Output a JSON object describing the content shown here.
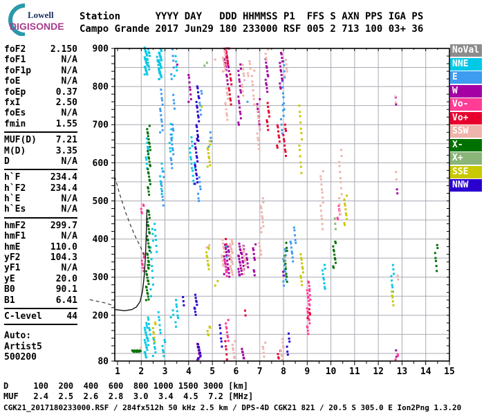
{
  "logo": {
    "line1": "Lowell",
    "line2": "DIGISONDE",
    "arc_color": "#2a99aa"
  },
  "header": {
    "line1": "Station      YYYY DAY   DDD HHMMSS P1  FFS S AXN PPS IGA PS",
    "line2": "Campo Grande 2017 Jun29 180 233000 RSF 005 2 713 100 03+ 36"
  },
  "parameters": {
    "groups": [
      [
        [
          "foF2",
          "2.150"
        ],
        [
          "foF1",
          "N/A"
        ],
        [
          "foF1p",
          "N/A"
        ],
        [
          "foE",
          "N/A"
        ],
        [
          "foEp",
          "0.37"
        ],
        [
          "fxI",
          "2.50"
        ],
        [
          "foEs",
          "N/A"
        ],
        [
          "fmin",
          "1.55"
        ]
      ],
      [
        [
          "MUF(D)",
          "7.21"
        ],
        [
          "M(D)",
          "3.35"
        ],
        [
          "D",
          "N/A"
        ]
      ],
      [
        [
          "h`F",
          "234.4"
        ],
        [
          "h`F2",
          "234.4"
        ],
        [
          "h`E",
          "N/A"
        ],
        [
          "h`Es",
          "N/A"
        ]
      ],
      [
        [
          "hmF2",
          "299.7"
        ],
        [
          "hmF1",
          "N/A"
        ],
        [
          "hmE",
          "110.0"
        ],
        [
          "yF2",
          "104.3"
        ],
        [
          "yF1",
          "N/A"
        ],
        [
          "yE",
          "20.0"
        ],
        [
          "B0",
          "90.1"
        ],
        [
          "B1",
          "6.41"
        ]
      ],
      [
        [
          "C-level",
          "44"
        ]
      ]
    ],
    "auto_lines": [
      "Auto:",
      "Artist5",
      "500200"
    ]
  },
  "bottom": {
    "d_row": {
      "label": "D",
      "values": [
        "100",
        "200",
        "400",
        "600",
        "800",
        "1000",
        "1500",
        "3000"
      ],
      "unit": "[km]"
    },
    "muf_row": {
      "label": "MUF",
      "values": [
        "2.4",
        "2.5",
        "2.6",
        "2.8",
        "3.0",
        "3.4",
        "4.5",
        "7.2"
      ],
      "unit": "[MHz]"
    }
  },
  "footer": {
    "text": "CGK21_2017180233000.RSF / 284fx512h 50 kHz 2.5 km / DPS-4D CGK21 821 / 20.5 S 305.0 E Ion2Png 1.3.20"
  },
  "chart_data": {
    "type": "scatter",
    "title": "Digisonde ionogram Campo Grande 2017 Jun29 233000",
    "xlabel": "[MHz]",
    "ylabel": "[km]",
    "x_axis": {
      "min": 1,
      "max": 15,
      "ticks": [
        1,
        2,
        3,
        4,
        5,
        6,
        7,
        8,
        9,
        10,
        11,
        12,
        13,
        14,
        15
      ],
      "minor_step": 0.5
    },
    "y_axis": {
      "min": 80,
      "max": 900,
      "tick_labels": [
        900,
        800,
        700,
        600,
        500,
        400,
        300,
        200,
        80
      ],
      "grid_step": 50,
      "minor_step": 20
    },
    "grid_color": "#a9a9b3",
    "colors": {
      "NoVal": "#8c8c8c",
      "NNE": "#00c8e6",
      "E": "#3d9bf0",
      "W": "#a400a4",
      "Vo-": "#ff3d96",
      "Vo+": "#e8002d",
      "SSW": "#efb4ab",
      "X-": "#007000",
      "X+": "#8ab478",
      "SSE": "#c9c900",
      "NNW": "#2b00cf"
    },
    "legend": [
      {
        "label": "NoVal",
        "color": "#8c8c8c"
      },
      {
        "label": "NNE",
        "color": "#00c8e6"
      },
      {
        "label": "E",
        "color": "#3d9bf0"
      },
      {
        "label": "W",
        "color": "#a400a4"
      },
      {
        "label": "Vo-",
        "color": "#ff3d96"
      },
      {
        "label": "Vo+",
        "color": "#e8002d"
      },
      {
        "label": "SSW",
        "color": "#efb4ab"
      },
      {
        "label": "X-",
        "color": "#007000"
      },
      {
        "label": "X+",
        "color": "#8ab478"
      },
      {
        "label": "SSE",
        "color": "#c9c900"
      },
      {
        "label": "NNW",
        "color": "#2b00cf"
      }
    ],
    "scatter_runs_format": "[freq_MHz, height_km_start, height_km_end, n_points]",
    "scatter": [
      {
        "c": "NNE",
        "runs": [
          [
            2.2,
            830,
            900,
            22
          ],
          [
            2.3,
            845,
            898,
            10
          ],
          [
            2.25,
            588,
            662,
            9
          ],
          [
            2.8,
            818,
            900,
            26
          ],
          [
            2.72,
            835,
            885,
            8
          ],
          [
            2.85,
            520,
            598,
            8
          ],
          [
            3.25,
            628,
            700,
            7
          ],
          [
            3.45,
            828,
            878,
            5
          ],
          [
            4.1,
            588,
            665,
            9
          ],
          [
            4.22,
            543,
            600,
            6
          ],
          [
            2.45,
            250,
            428,
            12
          ],
          [
            2.6,
            368,
            438,
            6
          ],
          [
            2.2,
            88,
            178,
            22
          ],
          [
            2.32,
            122,
            196,
            9
          ],
          [
            2.55,
            95,
            142,
            7
          ],
          [
            2.78,
            152,
            208,
            6
          ],
          [
            2.95,
            93,
            137,
            6
          ],
          [
            3.5,
            172,
            240,
            8
          ],
          [
            9.7,
            268,
            332,
            9
          ],
          [
            12.6,
            262,
            330,
            8
          ],
          [
            5.62,
            368,
            380,
            2
          ],
          [
            3.3,
            193,
            213,
            3
          ]
        ]
      },
      {
        "c": "E",
        "runs": [
          [
            2.85,
            678,
            790,
            13
          ],
          [
            2.9,
            488,
            575,
            8
          ],
          [
            3.3,
            588,
            700,
            14
          ],
          [
            3.32,
            818,
            898,
            6
          ],
          [
            3.35,
            742,
            778,
            4
          ],
          [
            4.5,
            728,
            790,
            7
          ],
          [
            4.45,
            498,
            560,
            7
          ],
          [
            4.9,
            642,
            680,
            4
          ],
          [
            8.0,
            742,
            868,
            10
          ],
          [
            7.95,
            675,
            750,
            7
          ],
          [
            8.05,
            278,
            375,
            12
          ],
          [
            8.35,
            343,
            395,
            7
          ],
          [
            8.5,
            388,
            432,
            5
          ],
          [
            6.5,
            755,
            765,
            1
          ],
          [
            5.66,
            352,
            360,
            1
          ]
        ]
      },
      {
        "c": "W",
        "runs": [
          [
            4.05,
            758,
            832,
            8
          ],
          [
            5.55,
            843,
            900,
            10
          ],
          [
            5.65,
            808,
            898,
            12
          ],
          [
            6.15,
            698,
            858,
            18
          ],
          [
            6.95,
            688,
            765,
            8
          ],
          [
            7.3,
            788,
            870,
            12
          ],
          [
            7.9,
            793,
            890,
            14
          ],
          [
            5.55,
            308,
            385,
            13
          ],
          [
            5.68,
            303,
            380,
            11
          ],
          [
            6.15,
            303,
            386,
            16
          ],
          [
            6.28,
            308,
            380,
            11
          ],
          [
            6.45,
            328,
            360,
            5
          ],
          [
            6.77,
            344,
            386,
            6
          ],
          [
            6.8,
            305,
            320,
            3
          ],
          [
            4.42,
            85,
            125,
            8
          ],
          [
            6.3,
            85,
            112,
            6
          ],
          [
            12.75,
            753,
            770,
            2
          ],
          [
            12.8,
            93,
            108,
            2
          ],
          [
            12.75,
            518,
            532,
            2
          ],
          [
            3.5,
            853,
            862,
            1
          ],
          [
            8.02,
            306,
            314,
            2
          ]
        ]
      },
      {
        "c": "Vo-",
        "runs": [
          [
            5.6,
            853,
            900,
            8
          ],
          [
            5.58,
            303,
            345,
            6
          ],
          [
            9.05,
            153,
            290,
            22
          ],
          [
            10.33,
            450,
            487,
            6
          ],
          [
            5.62,
            133,
            186,
            8
          ],
          [
            2.08,
            318,
            362,
            8
          ],
          [
            2.05,
            466,
            492,
            5
          ],
          [
            12.78,
            84,
            100,
            3
          ],
          [
            9.1,
            243,
            262,
            3
          ]
        ]
      },
      {
        "c": "Vo+",
        "runs": [
          [
            5.6,
            858,
            900,
            9
          ],
          [
            5.75,
            753,
            832,
            10
          ],
          [
            7.35,
            688,
            755,
            9
          ],
          [
            7.78,
            638,
            700,
            8
          ],
          [
            8.05,
            618,
            700,
            10
          ],
          [
            5.6,
            86,
            132,
            5
          ],
          [
            7.82,
            85,
            105,
            4
          ],
          [
            9.07,
            193,
            216,
            4
          ],
          [
            5.55,
            388,
            400,
            2
          ],
          [
            6.4,
            198,
            214,
            2
          ]
        ]
      },
      {
        "c": "SSW",
        "runs": [
          [
            5.5,
            838,
            900,
            12
          ],
          [
            5.6,
            713,
            795,
            10
          ],
          [
            6.3,
            778,
            855,
            9
          ],
          [
            6.55,
            826,
            868,
            5
          ],
          [
            6.72,
            753,
            840,
            8
          ],
          [
            6.95,
            638,
            745,
            12
          ],
          [
            7.3,
            868,
            895,
            4
          ],
          [
            8.1,
            828,
            868,
            5
          ],
          [
            9.62,
            428,
            578,
            14
          ],
          [
            10.4,
            463,
            632,
            13
          ],
          [
            7.1,
            418,
            505,
            11
          ],
          [
            5.8,
            308,
            396,
            24
          ],
          [
            5.45,
            328,
            396,
            10
          ],
          [
            6.35,
            308,
            380,
            10
          ],
          [
            7.0,
            352,
            388,
            6
          ],
          [
            5.9,
            86,
            130,
            7
          ],
          [
            7.95,
            84,
            136,
            8
          ],
          [
            5.15,
            868,
            877,
            1
          ],
          [
            12.78,
            292,
            306,
            2
          ],
          [
            12.72,
            758,
            772,
            2
          ],
          [
            12.78,
            558,
            576,
            2
          ],
          [
            4.82,
            376,
            386,
            2
          ],
          [
            1.95,
            112,
            118,
            1
          ],
          [
            7.18,
            93,
            128,
            5
          ]
        ]
      },
      {
        "c": "X-",
        "runs": [
          [
            2.26,
            238,
            332,
            18
          ],
          [
            2.3,
            332,
            476,
            24
          ],
          [
            2.33,
            518,
            668,
            24
          ],
          [
            10.15,
            323,
            395,
            11
          ],
          [
            8.1,
            288,
            390,
            10
          ],
          [
            14.45,
            318,
            386,
            7
          ],
          [
            2.3,
            675,
            695,
            4
          ]
        ]
      },
      {
        "c": "X+",
        "runs": [
          [
            4.72,
            853,
            864,
            2
          ],
          [
            8.06,
            328,
            356,
            3
          ],
          [
            10.2,
            428,
            452,
            3
          ]
        ]
      },
      {
        "c": "SSE",
        "runs": [
          [
            4.85,
            588,
            655,
            10
          ],
          [
            8.72,
            573,
            750,
            13
          ],
          [
            8.78,
            281,
            360,
            11
          ],
          [
            10.62,
            435,
            512,
            10
          ],
          [
            4.8,
            321,
            380,
            9
          ],
          [
            2.55,
            133,
            183,
            7
          ],
          [
            4.85,
            146,
            172,
            5
          ],
          [
            5.17,
            278,
            288,
            2
          ],
          [
            12.6,
            228,
            262,
            5
          ],
          [
            4.55,
            740,
            750,
            1
          ]
        ]
      },
      {
        "c": "NNW",
        "runs": [
          [
            4.32,
            543,
            665,
            17
          ],
          [
            4.38,
            658,
            802,
            18
          ],
          [
            4.3,
            203,
            252,
            9
          ],
          [
            4.45,
            84,
            124,
            9
          ],
          [
            5.35,
            118,
            176,
            6
          ],
          [
            3.78,
            228,
            246,
            3
          ],
          [
            8.2,
            95,
            152,
            6
          ]
        ]
      }
    ],
    "e_trace_horizontal": {
      "c": "X-",
      "f0": 1.62,
      "f1": 1.97,
      "km": 106,
      "n": 11
    },
    "trace_hprofile": [
      [
        0.9,
        215
      ],
      [
        1.3,
        212
      ],
      [
        1.6,
        215
      ],
      [
        1.8,
        222
      ],
      [
        1.95,
        236
      ],
      [
        2.05,
        262
      ],
      [
        2.12,
        300
      ],
      [
        2.17,
        345
      ],
      [
        2.2,
        390
      ],
      [
        2.22,
        430
      ],
      [
        2.235,
        460
      ],
      [
        2.24,
        478
      ]
    ],
    "trace_muf_dashed": [
      [
        0.88,
        564
      ],
      [
        1.1,
        516
      ],
      [
        1.35,
        468
      ],
      [
        1.6,
        428
      ],
      [
        1.8,
        400
      ],
      [
        1.95,
        382
      ],
      [
        2.08,
        364
      ],
      [
        2.15,
        354
      ]
    ],
    "trace_stub_dashed": [
      [
        -0.17,
        241
      ],
      [
        0.5,
        232
      ],
      [
        0.88,
        224
      ]
    ]
  }
}
